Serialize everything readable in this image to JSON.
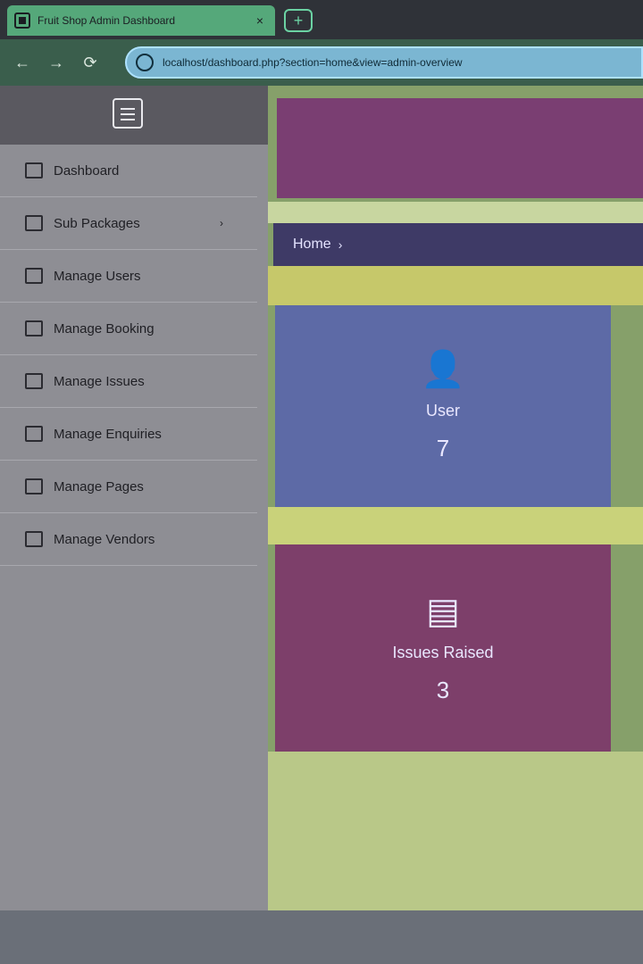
{
  "browser": {
    "tab_title": "Fruit Shop Admin Dashboard",
    "tab_close": "×",
    "new_tab": "+",
    "back": "←",
    "forward": "→",
    "reload": "⟳",
    "url": "localhost/dashboard.php?section=home&view=admin-overview"
  },
  "sidebar": {
    "items": [
      {
        "label": "Dashboard",
        "icon": "dashboard-icon"
      },
      {
        "label": "Sub Packages",
        "icon": "package-icon",
        "caret": "›"
      },
      {
        "label": "Manage Users",
        "icon": "users-icon"
      },
      {
        "label": "Manage Booking",
        "icon": "booking-icon"
      },
      {
        "label": "Manage Issues",
        "icon": "issues-icon"
      },
      {
        "label": "Manage Enquiries",
        "icon": "enquiries-icon"
      },
      {
        "label": "Manage Pages",
        "icon": "pages-icon"
      },
      {
        "label": "Manage Vendors",
        "icon": "vendors-icon"
      }
    ]
  },
  "main": {
    "breadcrumb": "Home",
    "breadcrumb_sep": "›",
    "cards": {
      "users": {
        "icon": "👤",
        "label": "User",
        "count": "7"
      },
      "issues": {
        "icon": "▤",
        "label": "Issues Raised",
        "count": "3"
      }
    }
  }
}
